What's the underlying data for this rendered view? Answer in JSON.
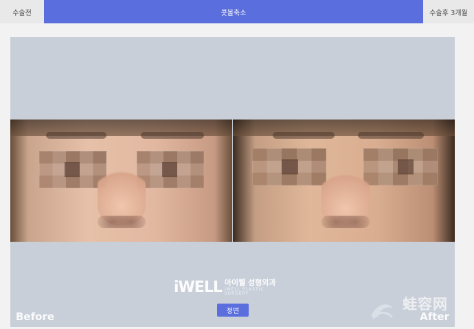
{
  "tabs": [
    {
      "label": "수술전"
    },
    {
      "label": "콧볼축소"
    },
    {
      "label": "수술후 3개월"
    }
  ],
  "viewer": {
    "before_label": "Before",
    "after_label": "After"
  },
  "logo": {
    "mark": "iWELL",
    "ko": "아이웰 성형외과",
    "en": "IWELL PLASTIC SURGERY"
  },
  "button": {
    "label": "정면"
  },
  "watermark": {
    "text": "蛙容网"
  },
  "colors": {
    "accent": "#5b6ede"
  }
}
